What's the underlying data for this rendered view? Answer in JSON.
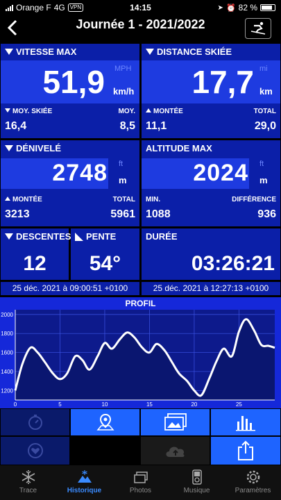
{
  "status": {
    "carrier": "Orange F",
    "network": "4G",
    "vpn": "VPN",
    "time": "14:15",
    "battery": "82 %",
    "battery_level": 0.82
  },
  "nav": {
    "title": "Journée 1 - 2021/2022"
  },
  "cards": {
    "speed": {
      "title": "VITESSE MAX",
      "value": "51,9",
      "unit_alt": "MPH",
      "unit": "km/h",
      "l1": "MOY. SKIÉE",
      "l2": "MOY.",
      "v1": "16,4",
      "v2": "8,5"
    },
    "distance": {
      "title": "DISTANCE SKIÉE",
      "value": "17,7",
      "unit_alt": "mi",
      "unit": "km",
      "l1": "MONTÉE",
      "l2": "TOTAL",
      "v1": "11,1",
      "v2": "29,0"
    },
    "elevation": {
      "title": "DÉNIVELÉ",
      "value": "2748",
      "unit_alt": "ft",
      "unit": "m",
      "l1": "MONTÉE",
      "l2": "TOTAL",
      "v1": "3213",
      "v2": "5961"
    },
    "altitude": {
      "title": "ALTITUDE MAX",
      "value": "2024",
      "unit_alt": "ft",
      "unit": "m",
      "l1": "MIN.",
      "l2": "DIFFÉRENCE",
      "v1": "1088",
      "v2": "936"
    },
    "descents": {
      "title": "DESCENTES",
      "value": "12"
    },
    "slope": {
      "title": "PENTE",
      "value": "54°"
    },
    "duration": {
      "title": "DURÉE",
      "value": "03:26:21"
    }
  },
  "times": {
    "start": "25 déc. 2021 à 09:00:51 +0100",
    "end": "25 déc. 2021 à 12:27:13 +0100"
  },
  "profile": {
    "title": "PROFIL"
  },
  "chart_data": {
    "type": "line",
    "title": "PROFIL",
    "xlabel": "",
    "ylabel": "",
    "xlim": [
      0,
      29
    ],
    "ylim": [
      1100,
      2050
    ],
    "xticks": [
      0,
      5,
      10,
      15,
      20,
      25
    ],
    "yticks": [
      1200,
      1400,
      1600,
      1800,
      2000
    ],
    "grid": true,
    "x": [
      0,
      0.8,
      1.7,
      2.5,
      3.3,
      4.2,
      5,
      5.8,
      6.7,
      7.5,
      8.3,
      9.2,
      10,
      10.8,
      11.7,
      12.5,
      13.3,
      14.2,
      15,
      15.8,
      16.7,
      17.5,
      18.3,
      19.2,
      20,
      20.8,
      21.7,
      22.5,
      23.3,
      24.2,
      25,
      25.8,
      26.7,
      27.5,
      28.3,
      29
    ],
    "y": [
      1200,
      1480,
      1650,
      1600,
      1500,
      1380,
      1320,
      1380,
      1560,
      1520,
      1420,
      1560,
      1700,
      1640,
      1740,
      1810,
      1760,
      1650,
      1600,
      1690,
      1620,
      1500,
      1380,
      1300,
      1200,
      1150,
      1330,
      1510,
      1640,
      1560,
      1820,
      1950,
      1830,
      1680,
      1670,
      1650
    ]
  },
  "actions": [
    {
      "name": "timer-action-button",
      "icon": "stopwatch-icon",
      "active": false
    },
    {
      "name": "map-action-button",
      "icon": "map-pin-icon",
      "active": true
    },
    {
      "name": "photos-action-button",
      "icon": "photos-icon",
      "active": true
    },
    {
      "name": "stats-action-button",
      "icon": "bar-chart-icon",
      "active": true
    },
    {
      "name": "favorite-action-button",
      "icon": "heart-icon",
      "active": false
    },
    {
      "name": "cloud-action-button",
      "icon": "cloud-upload-icon",
      "active": false
    },
    {
      "name": "share-action-button",
      "icon": "share-icon",
      "active": true
    }
  ],
  "tabs": [
    {
      "label": "Trace",
      "icon": "snowflake-icon"
    },
    {
      "label": "Historique",
      "icon": "history-icon",
      "active": true
    },
    {
      "label": "Photos",
      "icon": "photos-icon"
    },
    {
      "label": "Musique",
      "icon": "music-player-icon"
    },
    {
      "label": "Paramètres",
      "icon": "gear-icon"
    }
  ],
  "colors": {
    "card": "#0b1fa8",
    "value_box": "#1e3be0",
    "profile_bg": "#1528d9",
    "accent": "#3a8bff"
  }
}
